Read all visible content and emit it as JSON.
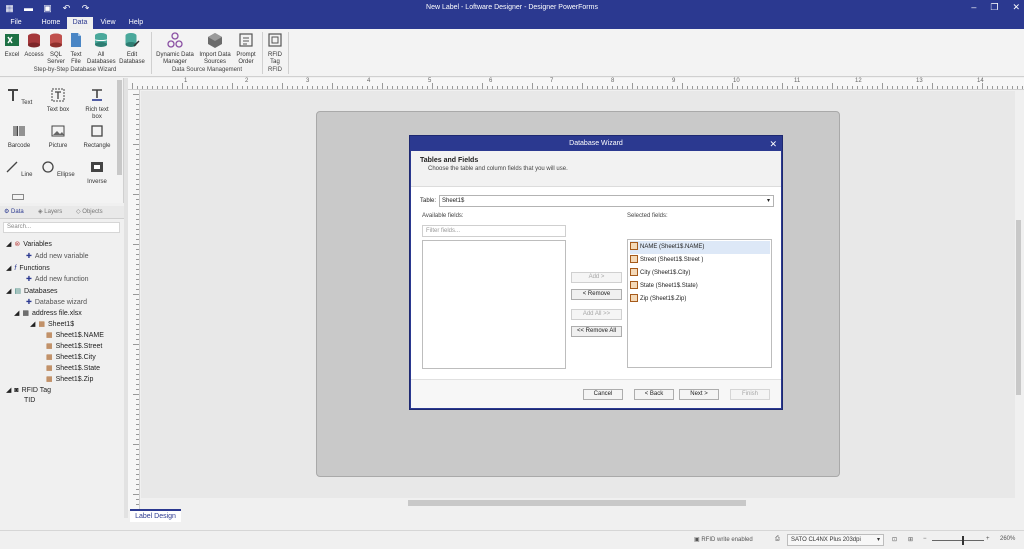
{
  "window": {
    "title": "New Label - Loftware Designer - Designer PowerForms"
  },
  "menu": {
    "tabs": [
      "File",
      "Home",
      "Data",
      "View",
      "Help"
    ],
    "active": "Data"
  },
  "ribbon": {
    "buttons": [
      {
        "label": "Excel",
        "icon": "excel-icon"
      },
      {
        "label": "Access",
        "icon": "access-icon"
      },
      {
        "label": "SQL Server",
        "icon": "sql-server-icon"
      },
      {
        "label": "Text File",
        "icon": "text-file-icon"
      },
      {
        "label": "All Databases",
        "icon": "database-icon"
      },
      {
        "label": "Edit Database",
        "icon": "edit-database-icon"
      },
      {
        "label": "Dynamic Data Manager",
        "icon": "dynamic-data-icon"
      },
      {
        "label": "Import Data Sources",
        "icon": "import-icon"
      },
      {
        "label": "Prompt Order",
        "icon": "prompt-order-icon"
      },
      {
        "label": "RFID Tag",
        "icon": "rfid-icon"
      }
    ],
    "groups": [
      "Step-by-Step Database Wizard",
      "Data Source Management",
      "RFID"
    ]
  },
  "tools": [
    {
      "label": "Text",
      "icon": "text-tool-icon"
    },
    {
      "label": "Text box",
      "icon": "text-box-icon"
    },
    {
      "label": "Rich text box",
      "icon": "rich-text-icon"
    },
    {
      "label": "Barcode",
      "icon": "barcode-icon"
    },
    {
      "label": "Picture",
      "icon": "picture-icon"
    },
    {
      "label": "Rectangle",
      "icon": "rectangle-icon"
    },
    {
      "label": "Line",
      "icon": "line-icon"
    },
    {
      "label": "Ellipse",
      "icon": "ellipse-icon"
    },
    {
      "label": "Inverse",
      "icon": "inverse-icon"
    }
  ],
  "panel": {
    "tabs": [
      "Data",
      "Layers",
      "Objects"
    ],
    "search_placeholder": "Search...",
    "tree": {
      "variables": "Variables",
      "add_variable": "Add new variable",
      "functions": "Functions",
      "add_function": "Add new function",
      "databases": "Databases",
      "db_wizard": "Database wizard",
      "file": "address file.xlsx",
      "sheet": "Sheet1$",
      "fields": [
        "Sheet1$.NAME",
        "Sheet1$.Street",
        "Sheet1$.City",
        "Sheet1$.State",
        "Sheet1$.Zip"
      ],
      "rfid": "RFID Tag",
      "tid": "TID"
    }
  },
  "ruler": {
    "labels": [
      "1",
      "2",
      "3",
      "4",
      "5",
      "6",
      "7",
      "8",
      "9",
      "10",
      "11",
      "12",
      "13",
      "14"
    ]
  },
  "doc_tab": "Label Design",
  "status": {
    "rfid": "RFID write enabled",
    "printer": "SATO CL4NX Plus 203dpi",
    "zoom": "260%"
  },
  "dialog": {
    "title": "Database Wizard",
    "heading": "Tables and Fields",
    "subheading": "Choose the table and column fields that you will use.",
    "table_label": "Table:",
    "table_value": "Sheet1$",
    "available_label": "Available fields:",
    "selected_label": "Selected fields:",
    "filter_placeholder": "Filter fields...",
    "selected_fields": [
      "NAME (Sheet1$.NAME)",
      "Street  (Sheet1$.Street )",
      "City (Sheet1$.City)",
      "State (Sheet1$.State)",
      "Zip (Sheet1$.Zip)"
    ],
    "buttons": {
      "add": "Add >",
      "remove": "< Remove",
      "add_all": "Add All >>",
      "remove_all": "<< Remove All",
      "cancel": "Cancel",
      "back": "< Back",
      "next": "Next >",
      "finish": "Finish"
    }
  },
  "colors": {
    "accent": "#2b3990",
    "selection": "#dde8f7"
  }
}
